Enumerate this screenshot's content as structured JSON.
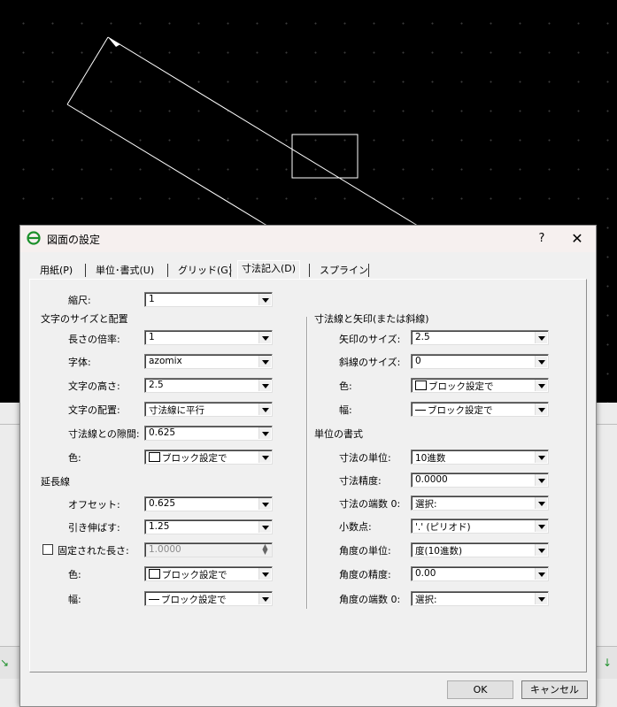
{
  "dialog": {
    "title": "図面の設定",
    "help_label": "?",
    "close_label": "✕"
  },
  "tabs": [
    {
      "label": "用紙(P)",
      "active": false
    },
    {
      "label": "単位･書式(U)",
      "active": false
    },
    {
      "label": "グリッド(G)",
      "active": false
    },
    {
      "label": "寸法記入(D)",
      "active": true
    },
    {
      "label": "スプライン",
      "active": false
    }
  ],
  "scale": {
    "label": "縮尺:",
    "value": "1"
  },
  "text_group": {
    "heading": "文字のサイズと配置",
    "length_factor": {
      "label": "長さの倍率:",
      "value": "1"
    },
    "font": {
      "label": "字体:",
      "value": "azomix"
    },
    "text_height": {
      "label": "文字の高さ:",
      "value": "2.5"
    },
    "text_placement": {
      "label": "文字の配置:",
      "value": "寸法線に平行"
    },
    "gap": {
      "label": "寸法線との隙間:",
      "value": "0.625"
    },
    "color": {
      "label": "色:",
      "value": "ブロック設定で"
    }
  },
  "ext_group": {
    "heading": "延長線",
    "offset": {
      "label": "オフセット:",
      "value": "0.625"
    },
    "extend": {
      "label": "引き伸ばす:",
      "value": "1.25"
    },
    "fixed_length": {
      "label": "固定された長さ:",
      "value": "1.0000",
      "checked": false
    },
    "color": {
      "label": "色:",
      "value": "ブロック設定で"
    },
    "width": {
      "label": "幅:",
      "value": "ブロック設定で"
    }
  },
  "arrow_group": {
    "heading": "寸法線と矢印(または斜線)",
    "arrow_size": {
      "label": "矢印のサイズ:",
      "value": "2.5"
    },
    "tick_size": {
      "label": "斜線のサイズ:",
      "value": "0"
    },
    "color": {
      "label": "色:",
      "value": "ブロック設定で"
    },
    "width": {
      "label": "幅:",
      "value": "ブロック設定で"
    }
  },
  "unit_group": {
    "heading": "単位の書式",
    "unit": {
      "label": "寸法の単位:",
      "value": "10進数"
    },
    "precision": {
      "label": "寸法精度:",
      "value": "0.0000"
    },
    "zero_suppress": {
      "label": "寸法の端数 0:",
      "value": "選択:"
    },
    "decimal": {
      "label": "小数点:",
      "value": "'.' (ピリオド)"
    },
    "angle_unit": {
      "label": "角度の単位:",
      "value": "度(10進数)"
    },
    "angle_precision": {
      "label": "角度の精度:",
      "value": "0.00"
    },
    "angle_zero": {
      "label": "角度の端数 0:",
      "value": "選択:"
    }
  },
  "buttons": {
    "ok": "OK",
    "cancel": "キャンセル"
  },
  "colors": {
    "canvas": "#000000",
    "dialog": "#f0f0f0",
    "accent": "#1c8f2a"
  }
}
